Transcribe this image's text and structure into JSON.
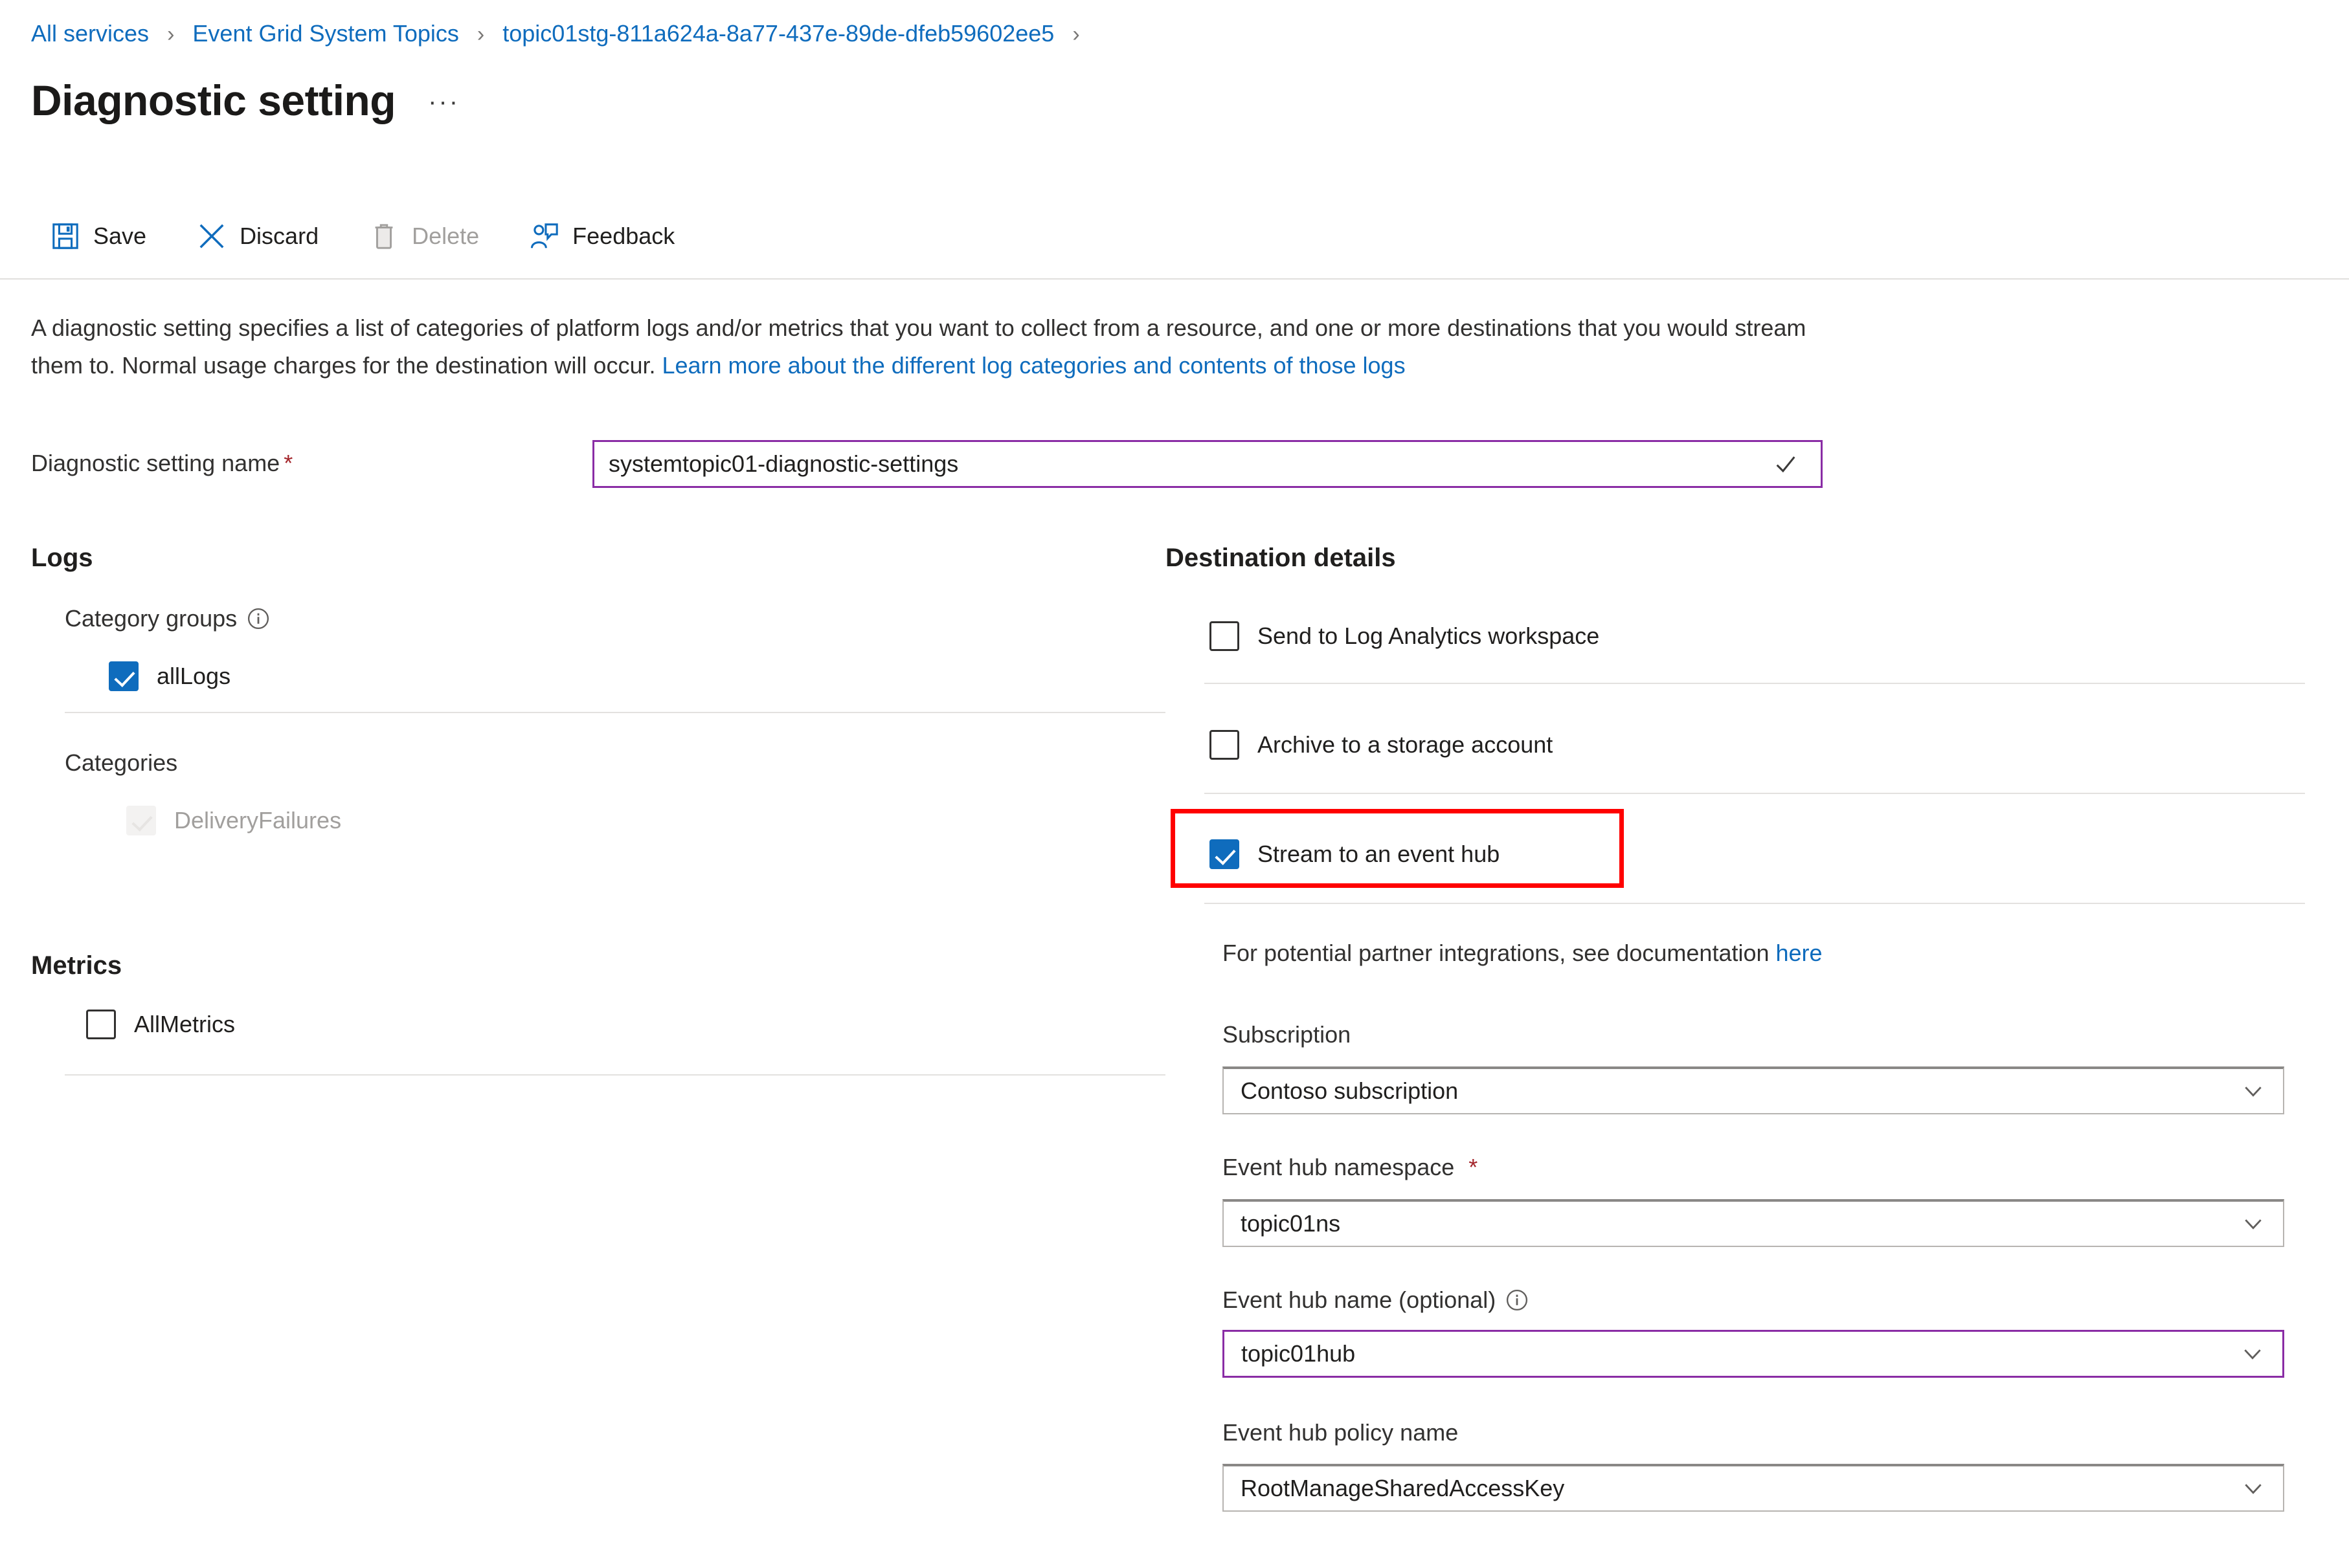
{
  "breadcrumb": {
    "items": [
      {
        "label": "All services"
      },
      {
        "label": "Event Grid System Topics"
      },
      {
        "label": "topic01stg-811a624a-8a77-437e-89de-dfeb59602ee5"
      }
    ],
    "separator": "›"
  },
  "header": {
    "title": "Diagnostic setting",
    "more_label": "···"
  },
  "toolbar": {
    "save_label": "Save",
    "discard_label": "Discard",
    "delete_label": "Delete",
    "feedback_label": "Feedback"
  },
  "description": {
    "text_part1": "A diagnostic setting specifies a list of categories of platform logs and/or metrics that you want to collect from a resource, and one or more destinations that you would stream them to. Normal usage charges for the destination will occur. ",
    "link_text": "Learn more about the different log categories and contents of those logs"
  },
  "name_field": {
    "label": "Diagnostic setting name",
    "required_mark": "*",
    "value": "systemtopic01-diagnostic-settings",
    "placeholder": "",
    "valid": true
  },
  "logs": {
    "heading": "Logs",
    "category_groups_label": "Category groups",
    "category_groups": [
      {
        "label": "allLogs",
        "checked": true,
        "disabled": false
      }
    ],
    "categories_label": "Categories",
    "categories": [
      {
        "label": "DeliveryFailures",
        "checked": true,
        "disabled": true
      }
    ]
  },
  "metrics": {
    "heading": "Metrics",
    "items": [
      {
        "label": "AllMetrics",
        "checked": false,
        "disabled": false
      }
    ]
  },
  "destination": {
    "heading": "Destination details",
    "options": [
      {
        "label": "Send to Log Analytics workspace",
        "checked": false
      },
      {
        "label": "Archive to a storage account",
        "checked": false
      },
      {
        "label": "Stream to an event hub",
        "checked": true,
        "highlighted": true
      }
    ],
    "partner_note_text": "For potential partner integrations, see documentation ",
    "partner_note_link": "here",
    "fields": [
      {
        "label": "Subscription",
        "required": false,
        "info": false,
        "value": "Contoso subscription",
        "focused": false
      },
      {
        "label": "Event hub namespace",
        "required": true,
        "info": false,
        "value": "topic01ns",
        "focused": false
      },
      {
        "label": "Event hub name (optional)",
        "required": false,
        "info": true,
        "value": "topic01hub",
        "focused": true
      },
      {
        "label": "Event hub policy name",
        "required": false,
        "info": false,
        "value": "RootManageSharedAccessKey",
        "focused": false
      }
    ]
  },
  "colors": {
    "link": "#0f6cbd",
    "accent_checkbox": "#0f6cbd",
    "focus_border": "#8a2da5",
    "highlight": "#ff0000",
    "required": "#a4262c"
  }
}
